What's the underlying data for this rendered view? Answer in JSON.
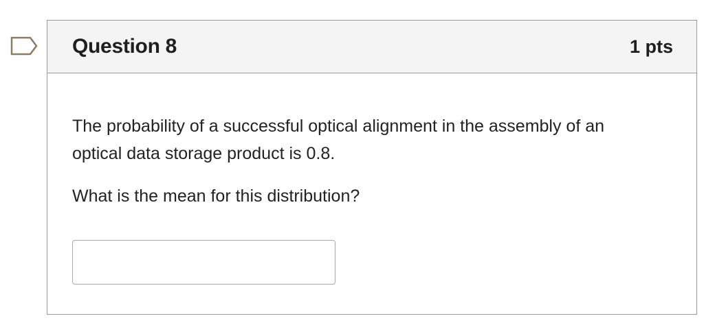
{
  "question": {
    "title": "Question 8",
    "points": "1 pts",
    "text": "The probability of a successful optical alignment in the assembly of an optical data storage product is 0.8.",
    "prompt": "What is the mean for this distribution?",
    "answer": {
      "value": "",
      "placeholder": ""
    }
  },
  "flag_icon": "bookmark-flag-icon",
  "colors": {
    "header_bg": "#f4f4f4",
    "border": "#9a9a9a",
    "flag_outline": "#8b7d64",
    "text": "#222222"
  }
}
